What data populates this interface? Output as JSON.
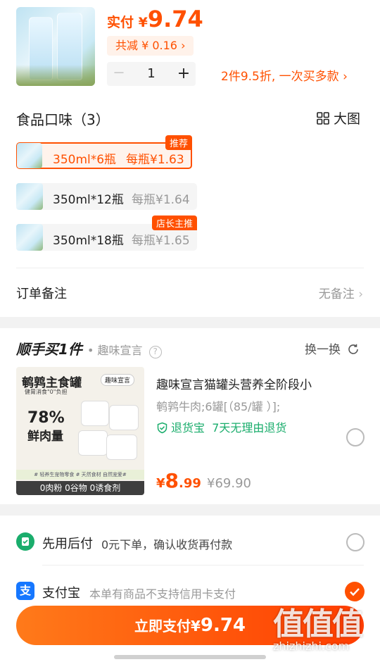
{
  "product": {
    "pay_prefix": "实付 ¥",
    "pay_amount": "9.74",
    "discount_label": "共减 ¥ 0.16",
    "quantity": "1",
    "minus": "－",
    "plus": "+",
    "promo": "2件9.5折, 一次买多款"
  },
  "flavors": {
    "title": "食品口味（3）",
    "big_view": "大图",
    "options": [
      {
        "spec": "350ml*6瓶",
        "per": "每瓶¥1.63",
        "badge": "推荐"
      },
      {
        "spec": "350ml*12瓶",
        "per": "每瓶¥1.64",
        "badge": ""
      },
      {
        "spec": "350ml*18瓶",
        "per": "每瓶¥1.65",
        "badge": "店长主推"
      }
    ]
  },
  "note": {
    "label": "订单备注",
    "value": "无备注"
  },
  "addon": {
    "brand": "顺手买1件",
    "shop": "• 趣味宣言",
    "swap": "换一换",
    "title": "趣味宣言猫罐头营养全阶段小",
    "spec": "鹌鹑牛肉;6罐[（85/罐 ）];",
    "return_label": "退货宝",
    "return_policy": "7天无理由退货",
    "price_symbol": "¥",
    "price_int": "8",
    "price_dec": ".99",
    "orig_price": "¥69.90",
    "img": {
      "headline": "鹌鹑主食罐",
      "subline": "健胃消食\"0\"负担",
      "brand_tag": "趣味宣言",
      "percent": "78%",
      "meat": "鲜肉量",
      "footer1": "# 轻养生宠物零食   # 天然食材 自然宠爱#",
      "footer2": "0肉粉 0谷物 0诱食剂"
    }
  },
  "payment": {
    "methods": [
      {
        "name": "先用后付",
        "desc": "0元下单，确认收货再付款"
      },
      {
        "name": "支付宝",
        "desc": "本单有商品不支持信用卡支付"
      }
    ]
  },
  "pay_button": {
    "label": "立即支付",
    "symbol": "¥",
    "amount": "9.74"
  },
  "watermark": {
    "text": "值值值",
    "url": "zhizhizhi.com"
  },
  "colors": {
    "accent": "#ff5000",
    "green": "#1aad6c",
    "alipay": "#1677ff"
  }
}
